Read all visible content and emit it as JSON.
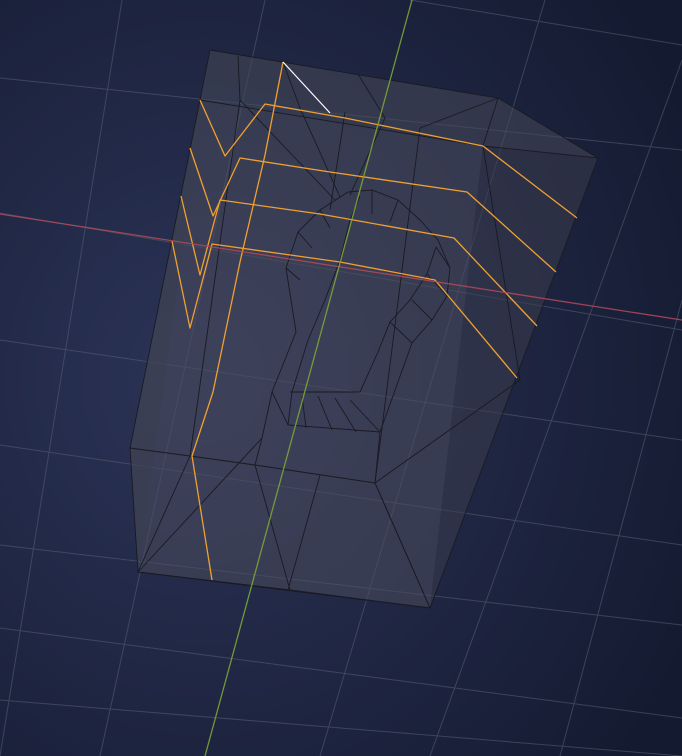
{
  "viewport": {
    "background_center": "#2c3458",
    "background_edge": "#141a30"
  },
  "colors": {
    "grid": "#5b6072",
    "axis_x": "#b54a5a",
    "axis_y": "#7aa636",
    "mesh_edge": "#1a1a22",
    "mesh_face": "#4a4c5c",
    "mesh_face_side": "#3a3d4d",
    "mesh_face_top": "#464857",
    "selected_edge": "#f0a030",
    "active_edge": "#ffffff"
  },
  "object": {
    "mode": "edit",
    "selection": "edge-loops"
  }
}
